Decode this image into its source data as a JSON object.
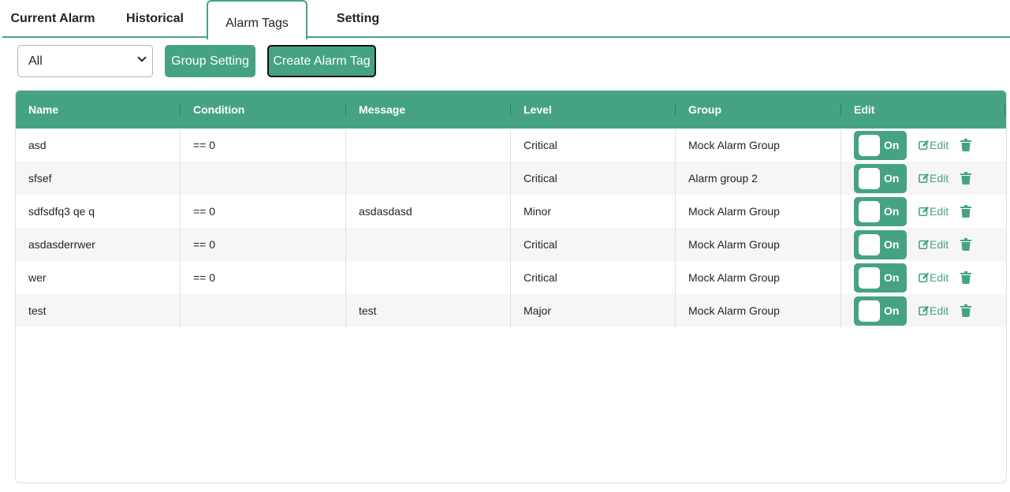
{
  "tabs": {
    "current_alarm": "Current Alarm",
    "historical": "Historical",
    "alarm_tags": "Alarm Tags",
    "setting": "Setting"
  },
  "toolbar": {
    "group_filter_value": "All",
    "group_setting_label": "Group Setting",
    "create_alarm_tag_label": "Create Alarm Tag"
  },
  "table": {
    "headers": {
      "name": "Name",
      "condition": "Condition",
      "message": "Message",
      "level": "Level",
      "group": "Group",
      "edit": "Edit"
    },
    "toggle_label": "On",
    "edit_label": "Edit",
    "rows": [
      {
        "name": "asd",
        "condition": "== 0",
        "message": "",
        "level": "Critical",
        "group": "Mock Alarm Group"
      },
      {
        "name": "sfsef",
        "condition": "",
        "message": "",
        "level": "Critical",
        "group": "Alarm group 2"
      },
      {
        "name": "sdfsdfq3 qe q",
        "condition": "== 0",
        "message": "asdasdasd",
        "level": "Minor",
        "group": "Mock Alarm Group"
      },
      {
        "name": "asdasderrwer",
        "condition": "== 0",
        "message": "",
        "level": "Critical",
        "group": "Mock Alarm Group"
      },
      {
        "name": "wer",
        "condition": "== 0",
        "message": "",
        "level": "Critical",
        "group": "Mock Alarm Group"
      },
      {
        "name": "test",
        "condition": "",
        "message": "test",
        "level": "Major",
        "group": "Mock Alarm Group"
      }
    ]
  },
  "colors": {
    "accent": "#45a383",
    "row_alt": "#f6f6f6"
  },
  "icons": {
    "edit": "edit-icon",
    "delete": "trash-icon",
    "select": "chevron-down-icon"
  }
}
